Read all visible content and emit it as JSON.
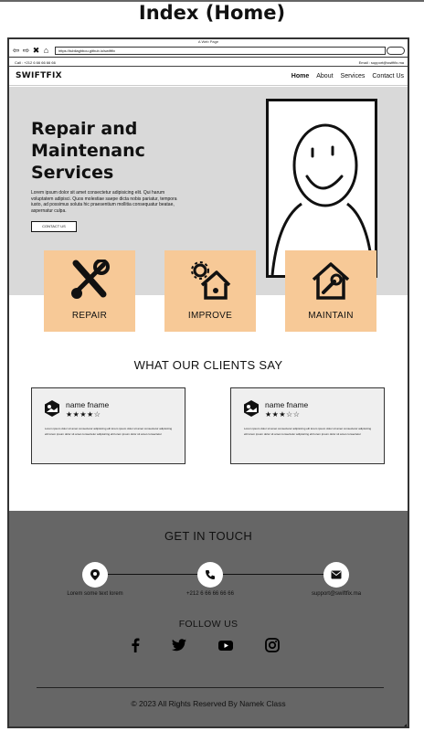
{
  "page_label": "Index (Home)",
  "browser": {
    "window_title": "A Web Page",
    "url": "https://tubilaghbou.github.io/swiftfix",
    "nav_icons": [
      "arrow-left-icon",
      "arrow-right-icon",
      "close-icon",
      "home-icon"
    ]
  },
  "contact_strip": {
    "phone": "Call : +212 6 66 66 66 66",
    "email": "Email : support@swiftfix.ma"
  },
  "nav": {
    "brand": "SWIFTFIX",
    "links": [
      "Home",
      "About",
      "Services",
      "Contact Us"
    ],
    "active": "Home"
  },
  "hero": {
    "title_line1": "Repair and",
    "title_line2": "Maintenanc",
    "title_line3": "Services",
    "text": "Lorem ipsum dolor sit amet consectetur adipisicing elit. Qui harum voluptatem adipisci. Quos molestiae saepe dicta nobis pariatur, tempora iusto, ad possimus soluta hic praesentium mollitia consequatur beatae, aspernatur culpa.",
    "button": "CONTACT US"
  },
  "services": [
    {
      "label": "REPAIR",
      "icon": "tools-icon"
    },
    {
      "label": "IMPROVE",
      "icon": "gear-house-icon"
    },
    {
      "label": "MAINTAIN",
      "icon": "wrench-house-icon"
    }
  ],
  "testimonials": {
    "title": "WHAT OUR CLIENTS SAY",
    "reviews": [
      {
        "name": "name fname",
        "stars": "★★★★☆",
        "rating": 4,
        "text": "Lorem ipsum dolor sit amet consectetur adipisicing elit lorem ipsum dolor sit amet consectetur adipisicing elit lorem ipsum dolor sit amet consectetur adipisicing elit lorem ipsum dolor sit amet consectetur"
      },
      {
        "name": "name fname",
        "stars": "★★★☆☆",
        "rating": 3,
        "text": "Lorem ipsum dolor sit amet consectetur adipisicing elit lorem ipsum dolor sit amet consectetur adipisicing elit lorem ipsum dolor sit amet consectetur adipisicing elit lorem ipsum dolor sit amet consectetur"
      }
    ]
  },
  "footer": {
    "title": "GET IN TOUCH",
    "contacts": [
      {
        "icon": "location-pin-icon",
        "text": "Lorem some text lorem"
      },
      {
        "icon": "phone-icon",
        "text": "+212 6 66 66 66 66"
      },
      {
        "icon": "mail-icon",
        "text": "support@swiftfix.ma"
      }
    ],
    "follow_title": "FOLLOW US",
    "socials": [
      "facebook-icon",
      "twitter-icon",
      "youtube-icon",
      "instagram-icon"
    ],
    "copyright": "© 2023 All Rights Reserved By Namek Class"
  }
}
